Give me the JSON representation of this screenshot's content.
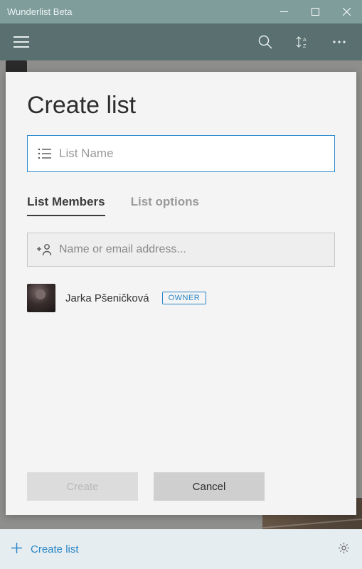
{
  "window": {
    "title": "Wunderlist Beta"
  },
  "dialog": {
    "title": "Create list",
    "list_name_placeholder": "List Name",
    "tabs": {
      "members": "List Members",
      "options": "List options"
    },
    "member_search_placeholder": "Name or email address...",
    "members": [
      {
        "name": "Jarka Pšeničková",
        "badge": "OWNER"
      }
    ],
    "buttons": {
      "create": "Create",
      "cancel": "Cancel"
    }
  },
  "bottom_bar": {
    "create_list": "Create list"
  }
}
